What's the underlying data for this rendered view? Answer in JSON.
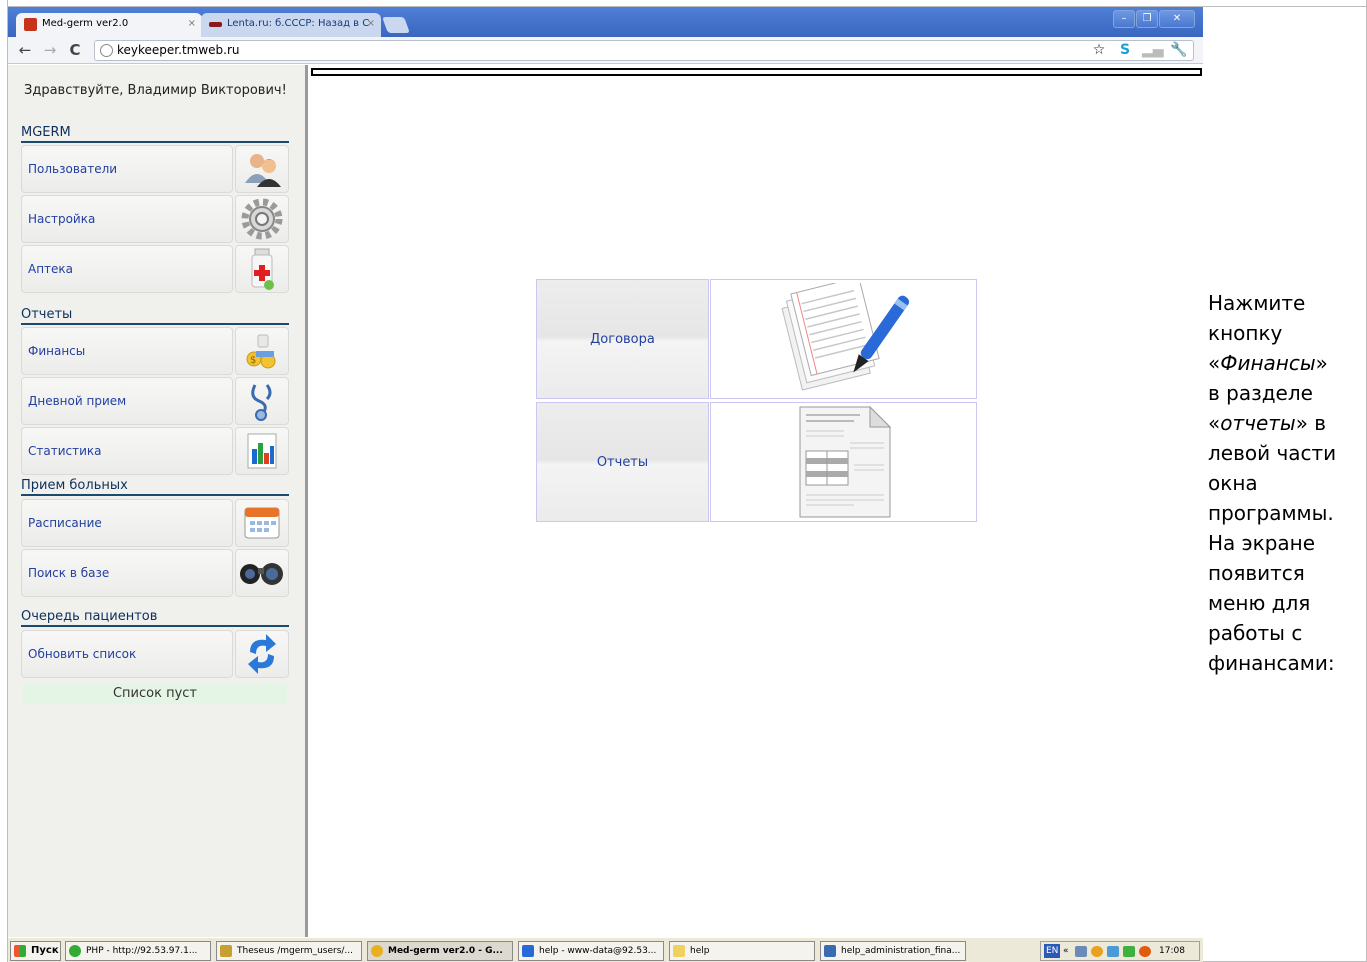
{
  "browser": {
    "tabs": [
      {
        "label": "Med-germ ver2.0",
        "active": true
      },
      {
        "label": "Lenta.ru: б.СССР: Назад в С",
        "active": false
      }
    ],
    "tab_close": "×",
    "url": "keykeeper.tmweb.ru",
    "window_buttons": {
      "minimize": "–",
      "restore": "❐",
      "close": "✕"
    }
  },
  "sidebar": {
    "greeting": "Здравствуйте, Владимир Викторович!",
    "sections": [
      {
        "title": "MGERM",
        "items": [
          {
            "label": "Пользователи",
            "icon": "users-icon"
          },
          {
            "label": "Настройка",
            "icon": "gear-icon"
          },
          {
            "label": "Аптека",
            "icon": "pharmacy-bottle-icon"
          }
        ]
      },
      {
        "title": "Отчеты",
        "items": [
          {
            "label": "Финансы",
            "icon": "money-icon"
          },
          {
            "label": "Дневной прием",
            "icon": "stethoscope-icon"
          },
          {
            "label": "Статистика",
            "icon": "bar-chart-icon"
          }
        ]
      },
      {
        "title": "Прием больных",
        "items": [
          {
            "label": "Расписание",
            "icon": "calendar-icon"
          },
          {
            "label": "Поиск в базе",
            "icon": "binoculars-icon"
          }
        ]
      },
      {
        "title": "Очередь пациентов",
        "items": [
          {
            "label": "Обновить список",
            "icon": "refresh-icon"
          }
        ]
      }
    ],
    "queue_status": "Список пуст"
  },
  "main": {
    "tiles": [
      {
        "label": "Договора",
        "icon": "documents-pen-icon"
      },
      {
        "label": "Отчеты",
        "icon": "report-document-icon"
      }
    ]
  },
  "taskbar": {
    "start": "Пуск",
    "tasks": [
      "PHP - http://92.53.97.1...",
      "Theseus /mgerm_users/...",
      "Med-germ ver2.0 - G...",
      "help - www-data@92.53...",
      "help",
      "help_administration_fina..."
    ],
    "tray_lang": "EN",
    "tray_arrows": "«",
    "clock": "17:08"
  },
  "doc_text": {
    "lines": [
      {
        "parts": [
          {
            "t": "Нажмите",
            "i": false
          }
        ]
      },
      {
        "parts": [
          {
            "t": "кнопку",
            "i": false
          }
        ]
      },
      {
        "parts": [
          {
            "t": "«",
            "i": false
          },
          {
            "t": "Финансы",
            "i": true
          },
          {
            "t": "»",
            "i": false
          }
        ]
      },
      {
        "parts": [
          {
            "t": "в разделе",
            "i": false
          }
        ]
      },
      {
        "parts": [
          {
            "t": "«",
            "i": false
          },
          {
            "t": "отчеты",
            "i": true
          },
          {
            "t": "» в",
            "i": false
          }
        ]
      },
      {
        "parts": [
          {
            "t": "левой части",
            "i": false
          }
        ]
      },
      {
        "parts": [
          {
            "t": "окна",
            "i": false
          }
        ]
      },
      {
        "parts": [
          {
            "t": "программы.",
            "i": false
          }
        ]
      },
      {
        "parts": [
          {
            "t": "На экране",
            "i": false
          }
        ]
      },
      {
        "parts": [
          {
            "t": "появится",
            "i": false
          }
        ]
      },
      {
        "parts": [
          {
            "t": "меню для",
            "i": false
          }
        ]
      },
      {
        "parts": [
          {
            "t": "работы с",
            "i": false
          }
        ]
      },
      {
        "parts": [
          {
            "t": "финансами:",
            "i": false
          }
        ]
      }
    ]
  },
  "colors": {
    "link": "#2440a0",
    "section": "#0d2f5e",
    "titlebar": "#3a66c0"
  }
}
